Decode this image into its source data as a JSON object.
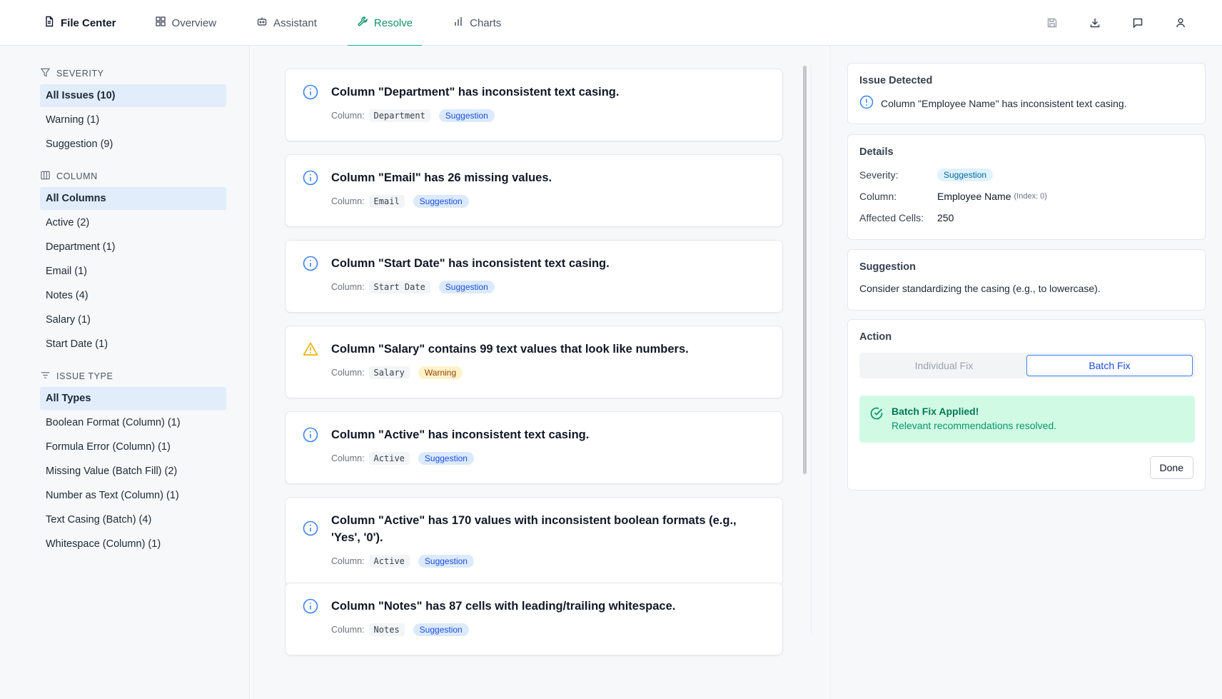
{
  "nav": {
    "brand": "File Center",
    "tabs": [
      {
        "label": "Overview",
        "icon": "grid-icon"
      },
      {
        "label": "Assistant",
        "icon": "bot-icon"
      },
      {
        "label": "Resolve",
        "icon": "wrench-icon",
        "active": true
      },
      {
        "label": "Charts",
        "icon": "bar-chart-icon"
      }
    ],
    "actions": [
      "save-icon",
      "download-icon",
      "message-icon",
      "user-icon"
    ]
  },
  "sidebar": {
    "severity": {
      "heading": "SEVERITY",
      "items": [
        "All Issues (10)",
        "Warning (1)",
        "Suggestion (9)"
      ],
      "selected": 0
    },
    "column": {
      "heading": "COLUMN",
      "items": [
        "All Columns",
        "Active (2)",
        "Department (1)",
        "Email (1)",
        "Notes (4)",
        "Salary (1)",
        "Start Date (1)"
      ],
      "selected": 0
    },
    "issue_type": {
      "heading": "ISSUE TYPE",
      "items": [
        "All Types",
        "Boolean Format (Column) (1)",
        "Formula Error (Column) (1)",
        "Missing Value (Batch Fill) (2)",
        "Number as Text (Column) (1)",
        "Text Casing (Batch) (4)",
        "Whitespace (Column) (1)"
      ],
      "selected": 0
    }
  },
  "issues": {
    "column_label": "Column:",
    "items": [
      {
        "title": "Column \"Department\" has inconsistent text casing.",
        "column": "Department",
        "severity": "Suggestion",
        "icon": "info-icon"
      },
      {
        "title": "Column \"Email\" has 26 missing values.",
        "column": "Email",
        "severity": "Suggestion",
        "icon": "info-icon"
      },
      {
        "title": "Column \"Start Date\" has inconsistent text casing.",
        "column": "Start Date",
        "severity": "Suggestion",
        "icon": "info-icon"
      },
      {
        "title": "Column \"Salary\" contains 99 text values that look like numbers.",
        "column": "Salary",
        "severity": "Warning",
        "icon": "warning-icon"
      },
      {
        "title": "Column \"Active\" has inconsistent text casing.",
        "column": "Active",
        "severity": "Suggestion",
        "icon": "info-icon"
      },
      {
        "title": "Column \"Active\" has 170 values with inconsistent boolean formats (e.g., 'Yes', '0').",
        "column": "Active",
        "severity": "Suggestion",
        "icon": "info-icon"
      },
      {
        "title": "Column \"Notes\" has 87 cells with leading/trailing whitespace.",
        "column": "Notes",
        "severity": "Suggestion",
        "icon": "info-icon"
      }
    ]
  },
  "detail": {
    "detected_title": "Issue Detected",
    "detected_text": "Column \"Employee Name\" has inconsistent text casing.",
    "details_title": "Details",
    "severity_label": "Severity:",
    "severity_value": "Suggestion",
    "column_label": "Column:",
    "column_value": "Employee Name",
    "column_index": "(Index: 0)",
    "cells_label": "Affected Cells:",
    "cells_value": "250",
    "suggestion_title": "Suggestion",
    "suggestion_text": "Consider standardizing the casing (e.g., to lowercase).",
    "action_title": "Action",
    "individual_fix": "Individual Fix",
    "batch_fix": "Batch Fix",
    "success_title": "Batch Fix Applied!",
    "success_text": "Relevant recommendations resolved.",
    "done": "Done"
  }
}
